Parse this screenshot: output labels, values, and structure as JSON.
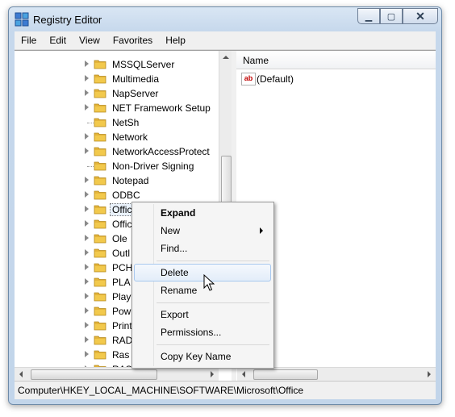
{
  "window": {
    "title": "Registry Editor",
    "icons": {
      "app": "registry-icon",
      "minimize": "minimize-icon",
      "maximize": "maximize-icon",
      "close": "close-icon"
    }
  },
  "menubar": {
    "items": [
      "File",
      "Edit",
      "View",
      "Favorites",
      "Help"
    ]
  },
  "tree": {
    "items": [
      "MSSQLServer",
      "Multimedia",
      "NapServer",
      "NET Framework Setup",
      "NetSh",
      "Network",
      "NetworkAccessProtect",
      "Non-Driver Signing",
      "Notepad",
      "ODBC",
      "Offic",
      "Offic",
      "Ole",
      "Outl",
      "PCH",
      "PLA",
      "Play",
      "Pow",
      "Print",
      "RAD",
      "Ras",
      "RAS"
    ],
    "selected": "Offic",
    "folder_color": "#f2c94c"
  },
  "value_pane": {
    "column_name": "Name",
    "values": [
      {
        "icon": "string-value-icon",
        "name": "(Default)"
      }
    ]
  },
  "status_bar": {
    "path": "Computer\\HKEY_LOCAL_MACHINE\\SOFTWARE\\Microsoft\\Office"
  },
  "context_menu": {
    "expand": "Expand",
    "new": "New",
    "find": "Find...",
    "delete": "Delete",
    "rename": "Rename",
    "export": "Export",
    "permissions": "Permissions...",
    "copy_key_name": "Copy Key Name",
    "hovered": "Delete"
  },
  "colors": {
    "frame": "#c6d8ec",
    "menu_highlight_border": "#a8c8ee"
  }
}
